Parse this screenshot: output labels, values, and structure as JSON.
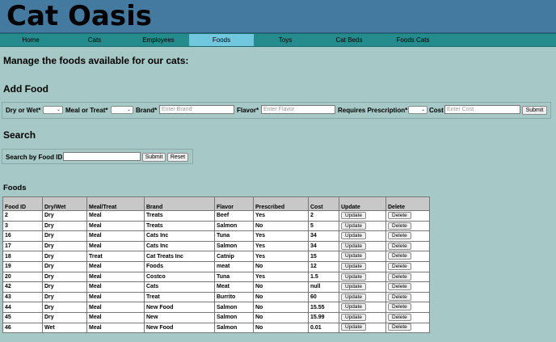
{
  "app": {
    "title": "Cat Oasis"
  },
  "nav": [
    {
      "label": "Home",
      "active": false
    },
    {
      "label": "Cats",
      "active": false
    },
    {
      "label": "Employees",
      "active": false
    },
    {
      "label": "Foods",
      "active": true
    },
    {
      "label": "Toys",
      "active": false
    },
    {
      "label": "Cat Beds",
      "active": false
    },
    {
      "label": "Foods Cats",
      "active": false
    }
  ],
  "page": {
    "heading": "Manage the foods available for our cats:",
    "add_heading": "Add Food",
    "search_heading": "Search",
    "table_heading": "Foods"
  },
  "add_form": {
    "dry_wet_label": "Dry or Wet*",
    "meal_treat_label": "Meal or Treat*",
    "brand_label": "Brand*",
    "brand_placeholder": "Enter Brand",
    "flavor_label": "Flavor*",
    "flavor_placeholder": "Enter Flavor",
    "prescription_label": "Requires Prescription*",
    "cost_label": "Cost",
    "cost_placeholder": "Enter Cost",
    "submit_label": "Submit"
  },
  "search_form": {
    "label": "Search by Food ID:",
    "value": "",
    "submit_label": "Submit",
    "reset_label": "Reset"
  },
  "table": {
    "headers": [
      "Food ID",
      "Dry/Wet",
      "Meal/Treat",
      "Brand",
      "Flavor",
      "Prescribed",
      "Cost",
      "Update",
      "Delete"
    ],
    "update_label": "Update",
    "delete_label": "Delete",
    "rows": [
      [
        "2",
        "Dry",
        "Meal",
        "Treats",
        "Beef",
        "Yes",
        "2"
      ],
      [
        "3",
        "Dry",
        "Meal",
        "Treats",
        "Salmon",
        "No",
        "5"
      ],
      [
        "16",
        "Dry",
        "Meal",
        "Cats Inc",
        "Tuna",
        "Yes",
        "34"
      ],
      [
        "17",
        "Dry",
        "Meal",
        "Cats Inc",
        "Salmon",
        "Yes",
        "34"
      ],
      [
        "18",
        "Dry",
        "Treat",
        "Cat Treats Inc",
        "Catnip",
        "Yes",
        "15"
      ],
      [
        "19",
        "Dry",
        "Meal",
        "Foods",
        "meat",
        "No",
        "12"
      ],
      [
        "20",
        "Dry",
        "Meal",
        "Costco",
        "Tuna",
        "Yes",
        "1.5"
      ],
      [
        "42",
        "Dry",
        "Meal",
        "Cats",
        "Meat",
        "No",
        "null"
      ],
      [
        "43",
        "Dry",
        "Meal",
        "Treat",
        "Burrito",
        "No",
        "60"
      ],
      [
        "44",
        "Dry",
        "Meal",
        "New Food",
        "Salmon",
        "No",
        "15.55"
      ],
      [
        "45",
        "Dry",
        "Meal",
        "New",
        "Salmon",
        "No",
        "15.99"
      ],
      [
        "46",
        "Wet",
        "Meal",
        "New Food",
        "Salmon",
        "No",
        "0.01"
      ]
    ]
  }
}
